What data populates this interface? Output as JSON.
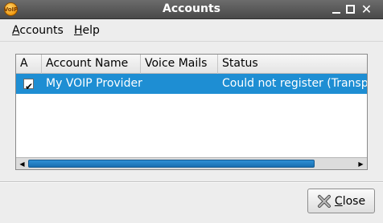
{
  "window": {
    "title": "Accounts",
    "app_icon_text": "VoIP"
  },
  "menubar": {
    "items": [
      {
        "label": "Accounts",
        "mnemonic": "A",
        "rest": "ccounts"
      },
      {
        "label": "Help",
        "mnemonic": "H",
        "rest": "elp"
      }
    ]
  },
  "accounts_list": {
    "columns": [
      "A",
      "Account Name",
      "Voice Mails",
      "Status"
    ],
    "rows": [
      {
        "active": true,
        "account_name": "My VOIP Provider",
        "voice_mails": "",
        "status": "Could not register (Transpo"
      }
    ],
    "selected_row": 0,
    "scroll_fraction_visible": 0.85
  },
  "buttons": {
    "close": {
      "label": "Close",
      "mnemonic": "C",
      "rest": "lose"
    }
  },
  "colors": {
    "selection": "#1e8ed3",
    "titlebar": "#5a5a5a"
  }
}
